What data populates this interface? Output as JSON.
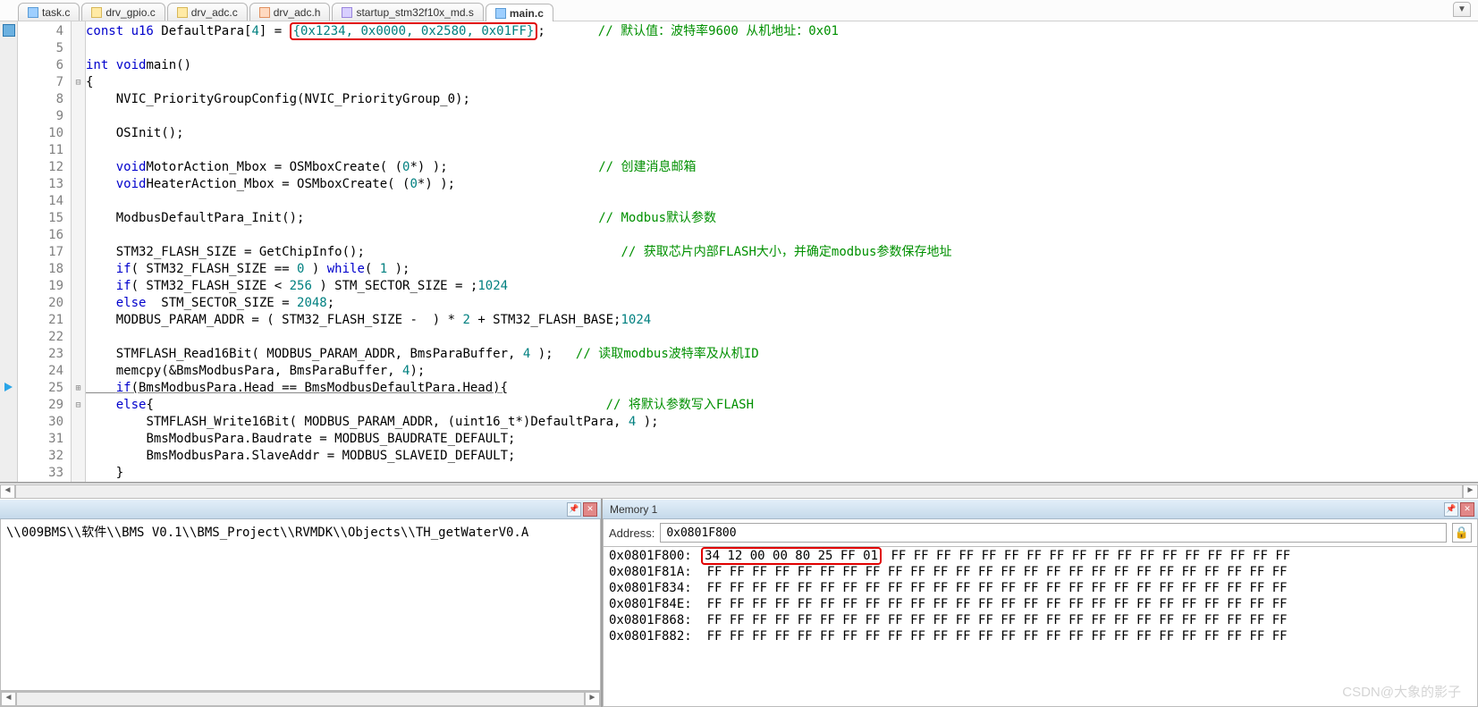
{
  "tabs": [
    {
      "label": "task.c",
      "iconClass": "ico-c",
      "active": false
    },
    {
      "label": "drv_gpio.c",
      "iconClass": "ico-cy",
      "active": false
    },
    {
      "label": "drv_adc.c",
      "iconClass": "ico-cy",
      "active": false
    },
    {
      "label": "drv_adc.h",
      "iconClass": "ico-co",
      "active": false
    },
    {
      "label": "startup_stm32f10x_md.s",
      "iconClass": "ico-s",
      "active": false
    },
    {
      "label": "main.c",
      "iconClass": "ico-c",
      "active": true
    }
  ],
  "code": {
    "lines": [
      {
        "n": 4,
        "mark": "bookmark",
        "fold": "",
        "pre": "const ",
        "ty": "u16 ",
        "plain1": "DefaultPara[",
        "num1": "4",
        "plain2": "] = ",
        "boxed": "{0x1234, 0x0000, 0x2580, 0x01FF}",
        "post": ";",
        "pad": "       ",
        "cm": "// 默认值：波特率9600 从机地址：0x01"
      },
      {
        "n": 5,
        "fold": "",
        "text": ""
      },
      {
        "n": 6,
        "fold": "",
        "pre": "int ",
        "fn": "main",
        "plain1": "(",
        "ty": "void",
        "plain2": ")"
      },
      {
        "n": 7,
        "fold": "⊟",
        "text": "{"
      },
      {
        "n": 8,
        "fold": "",
        "indent": "    ",
        "fn": "NVIC_PriorityGroupConfig",
        "plain1": "(NVIC_PriorityGroup_0);"
      },
      {
        "n": 9,
        "fold": "",
        "text": ""
      },
      {
        "n": 10,
        "fold": "",
        "indent": "    ",
        "fn": "OSInit",
        "plain1": "();"
      },
      {
        "n": 11,
        "fold": "",
        "text": ""
      },
      {
        "n": 12,
        "fold": "",
        "indent": "    ",
        "plain0": "MotorAction_Mbox = ",
        "fn": "OSMboxCreate",
        "plain1": "( (",
        "ty": "void",
        "plain2": "*)",
        "num1": "0",
        "plain3": " );",
        "pad": "                    ",
        "cm": "// 创建消息邮箱"
      },
      {
        "n": 13,
        "fold": "",
        "indent": "    ",
        "plain0": "HeaterAction_Mbox = ",
        "fn": "OSMboxCreate",
        "plain1": "( (",
        "ty": "void",
        "plain2": "*)",
        "num1": "0",
        "plain3": " );"
      },
      {
        "n": 14,
        "fold": "",
        "text": ""
      },
      {
        "n": 15,
        "fold": "",
        "indent": "    ",
        "fn": "ModbusDefaultPara_Init",
        "plain1": "();",
        "pad": "                                       ",
        "cm": "// Modbus默认参数"
      },
      {
        "n": 16,
        "fold": "",
        "text": ""
      },
      {
        "n": 17,
        "fold": "",
        "indent": "    ",
        "plain0": "STM32_FLASH_SIZE = ",
        "fn": "GetChipInfo",
        "plain1": "();",
        "pad": "                                  ",
        "cm": "// 获取芯片内部FLASH大小，并确定modbus参数保存地址"
      },
      {
        "n": 18,
        "fold": "",
        "indent": "    ",
        "kw": "if",
        "plain1": "( STM32_FLASH_SIZE == ",
        "num1": "0",
        "plain2": " ) ",
        "kw2": "while",
        "plain3": "( ",
        "num2": "1",
        "plain4": " );"
      },
      {
        "n": 19,
        "fold": "",
        "indent": "    ",
        "kw": "if",
        "plain1": "( STM32_FLASH_SIZE < ",
        "num1": "256",
        "plain2": " ) STM_SECTOR_SIZE = ",
        "num2": "1024",
        "plain3": ";"
      },
      {
        "n": 20,
        "fold": "",
        "indent": "    ",
        "kw": "else",
        "plain1": "  STM_SECTOR_SIZE = ",
        "num1": "2048",
        "plain2": ";"
      },
      {
        "n": 21,
        "fold": "",
        "indent": "    ",
        "plain0": "MODBUS_PARAM_ADDR = ( STM32_FLASH_SIZE - ",
        "num1": "2",
        "plain1": " ) * ",
        "num2": "1024",
        "plain2": " + STM32_FLASH_BASE;"
      },
      {
        "n": 22,
        "fold": "",
        "text": ""
      },
      {
        "n": 23,
        "fold": "",
        "indent": "    ",
        "fn": "STMFLASH_Read16Bit",
        "plain1": "( MODBUS_PARAM_ADDR, BmsParaBuffer, ",
        "num1": "4",
        "plain2": " );",
        "pad": "   ",
        "cm": "// 读取modbus波特率及从机ID"
      },
      {
        "n": 24,
        "fold": "",
        "indent": "    ",
        "fn": "memcpy",
        "plain1": "(&BmsModbusPara, BmsParaBuffer, ",
        "num1": "4",
        "plain2": ");"
      },
      {
        "n": 25,
        "mark": "arrow",
        "fold": "⊞",
        "indent": "    ",
        "kw": "if",
        "plain1": "(BmsModbusPara.Head == BmsModbusDefaultPara.Head){",
        "underline": true
      },
      {
        "n": 29,
        "fold": "⊟",
        "indent": "    ",
        "kw": "else",
        "plain1": "{",
        "pad": "                                                            ",
        "cm": "// 将默认参数写入FLASH"
      },
      {
        "n": 30,
        "fold": "",
        "indent": "        ",
        "fn": "STMFLASH_Write16Bit",
        "plain1": "( MODBUS_PARAM_ADDR, (uint16_t*)DefaultPara, ",
        "num1": "4",
        "plain2": " );"
      },
      {
        "n": 31,
        "fold": "",
        "indent": "        ",
        "plain0": "BmsModbusPara.Baudrate = MODBUS_BAUDRATE_DEFAULT;"
      },
      {
        "n": 32,
        "fold": "",
        "indent": "        ",
        "plain0": "BmsModbusPara.SlaveAddr = MODBUS_SLAVEID_DEFAULT;"
      },
      {
        "n": 33,
        "fold": "",
        "indent": "    ",
        "plain0": "}"
      }
    ]
  },
  "output": {
    "text": "\\\\009BMS\\\\软件\\\\BMS V0.1\\\\BMS_Project\\\\RVMDK\\\\Objects\\\\TH_getWaterV0.A"
  },
  "memory": {
    "title": "Memory 1",
    "addressLabel": "Address:",
    "addressValue": "0x0801F800",
    "rows": [
      {
        "addr": "0x0801F800:",
        "boxed": "34 12 00 00 80 25 FF 01",
        "rest": " FF FF FF FF FF FF FF FF FF FF FF FF FF FF FF FF FF FF"
      },
      {
        "addr": "0x0801F81A:",
        "rest": " FF FF FF FF FF FF FF FF FF FF FF FF FF FF FF FF FF FF FF FF FF FF FF FF FF FF"
      },
      {
        "addr": "0x0801F834:",
        "rest": " FF FF FF FF FF FF FF FF FF FF FF FF FF FF FF FF FF FF FF FF FF FF FF FF FF FF"
      },
      {
        "addr": "0x0801F84E:",
        "rest": " FF FF FF FF FF FF FF FF FF FF FF FF FF FF FF FF FF FF FF FF FF FF FF FF FF FF"
      },
      {
        "addr": "0x0801F868:",
        "rest": " FF FF FF FF FF FF FF FF FF FF FF FF FF FF FF FF FF FF FF FF FF FF FF FF FF FF"
      },
      {
        "addr": "0x0801F882:",
        "rest": " FF FF FF FF FF FF FF FF FF FF FF FF FF FF FF FF FF FF FF FF FF FF FF FF FF FF"
      }
    ]
  },
  "watermark": "CSDN@大象的影子"
}
